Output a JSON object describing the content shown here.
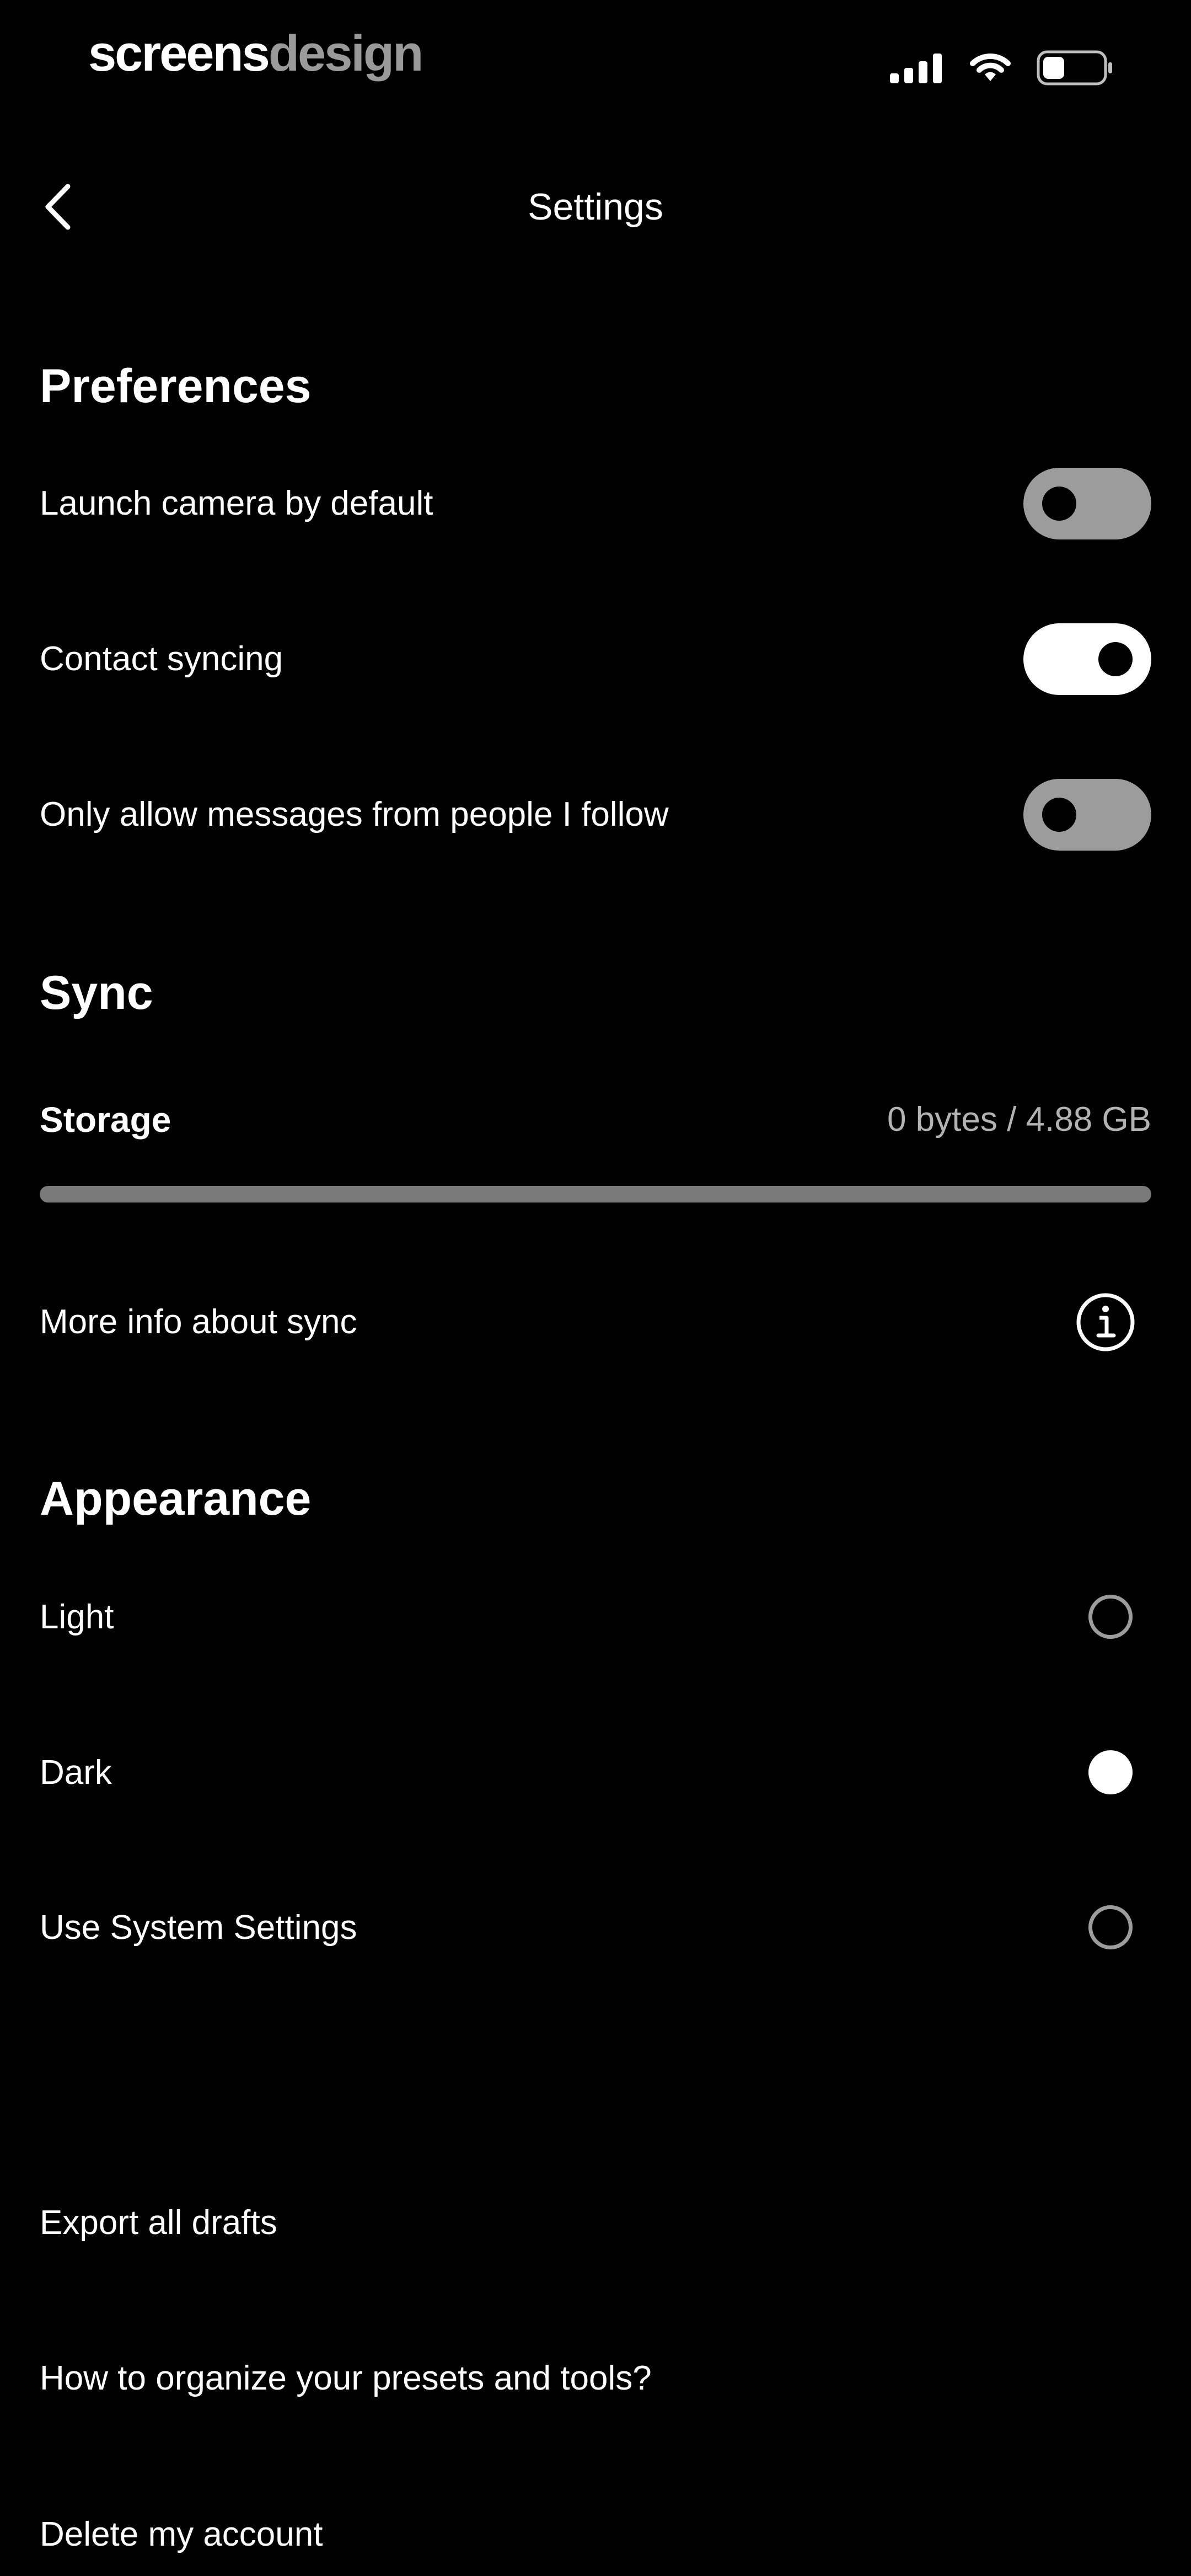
{
  "status_bar": {
    "brand_part1": "screens",
    "brand_part2": "design",
    "icons": [
      "signal-icon",
      "wifi-icon",
      "battery-icon"
    ]
  },
  "nav": {
    "back_icon": "chevron-left-icon",
    "title": "Settings"
  },
  "preferences": {
    "title": "Preferences",
    "items": [
      {
        "label": "Launch camera by default",
        "enabled": false
      },
      {
        "label": "Contact syncing",
        "enabled": true
      },
      {
        "label": "Only allow messages from people I follow",
        "enabled": false
      }
    ]
  },
  "sync": {
    "title": "Sync",
    "storage_label": "Storage",
    "storage_value": "0 bytes / 4.88 GB",
    "storage_fraction": 0,
    "more_info_label": "More info about sync",
    "info_icon": "info-icon"
  },
  "appearance": {
    "title": "Appearance",
    "options": [
      {
        "label": "Light",
        "selected": false
      },
      {
        "label": "Dark",
        "selected": true
      },
      {
        "label": "Use System Settings",
        "selected": false
      }
    ]
  },
  "actions": {
    "export_drafts": "Export all drafts",
    "organize_presets": "How to organize your presets and tools?",
    "delete_account": "Delete my account"
  },
  "colors": {
    "background": "#000000",
    "text": "#ffffff",
    "muted": "#9c9c9c"
  }
}
